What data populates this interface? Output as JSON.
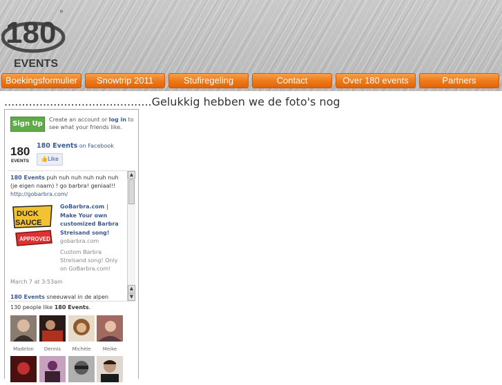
{
  "header": {
    "logo_number": "180",
    "logo_word": "EVENTS",
    "logo_degree": "°"
  },
  "nav": {
    "items": [
      {
        "label": "Boekingsformulier"
      },
      {
        "label": "Snowtrip 2011"
      },
      {
        "label": "Stufiregeling"
      },
      {
        "label": "Contact"
      },
      {
        "label": "Over 180 events"
      },
      {
        "label": "Partners"
      }
    ]
  },
  "main": {
    "headline": "..........................................Gelukkig hebben we de foto's nog"
  },
  "facebook": {
    "signup_label": "Sign Up",
    "signup_text_pre": "Create an account or ",
    "signup_text_link": "log in",
    "signup_text_post": " to see what your friends like.",
    "page_name": "180 Events",
    "page_suffix": " on Facebook",
    "like_label": "Like",
    "post1": {
      "author": "180 Events",
      "text": " puh nuh nuh nuh nuh nuh (je eigen naam) ! go barbra! geniaal!!",
      "link": "http://gobarbra.com/",
      "attachment_image_text": "DUCK SAUCE",
      "attachment_badge": "APPROVED",
      "attachment_title": "GoBarbra.com | Make Your own customized Barbra Streisand song!",
      "attachment_domain": "gobarbra.com",
      "attachment_desc": "Custom Barbra Streisand song! Only on GoBarbra.com!",
      "time": "March 7 at 3:53am"
    },
    "post2": {
      "author": "180 Events",
      "text": " sneeuwval in de alpen"
    },
    "fans_count_pre": "130 people like ",
    "fans_count_page": "180 Events",
    "fans_count_post": ".",
    "fans": [
      {
        "name": "Madelon"
      },
      {
        "name": "Dennis"
      },
      {
        "name": "Michèle"
      },
      {
        "name": "Meike"
      }
    ]
  }
}
